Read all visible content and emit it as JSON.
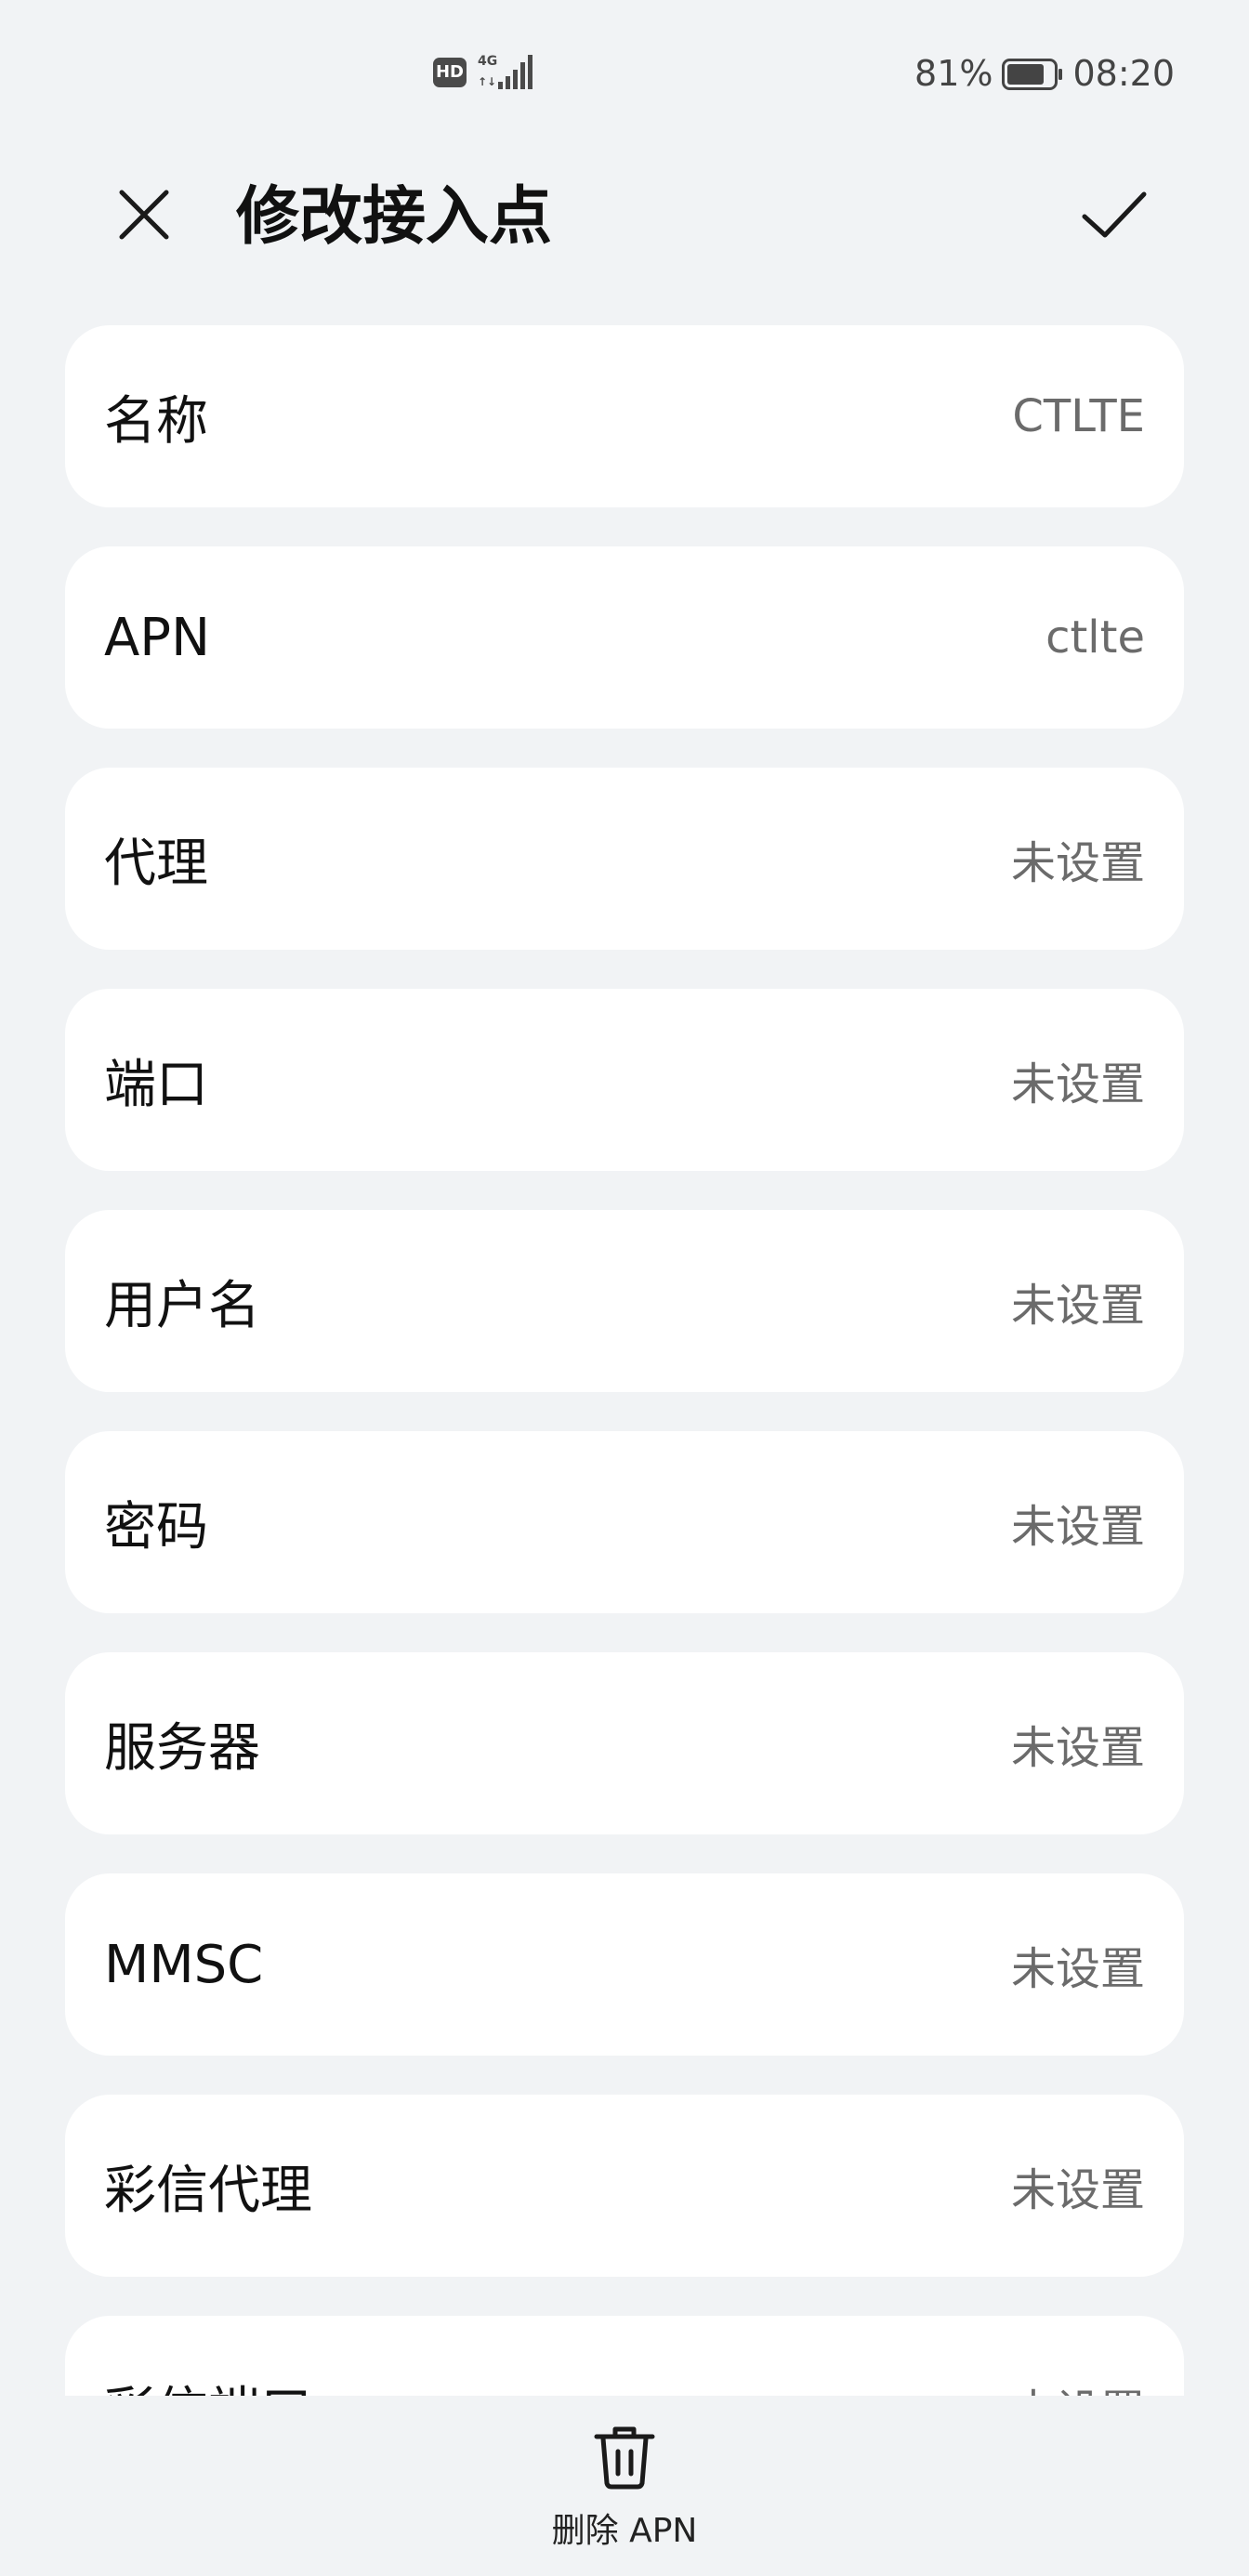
{
  "status_bar": {
    "hd_badge": "HD",
    "network": "4G",
    "battery_percent": "81%",
    "battery_level": 0.81,
    "time": "08:20"
  },
  "app_bar": {
    "title": "修改接入点",
    "close_icon": "close-icon",
    "confirm_icon": "check-icon"
  },
  "fields": [
    {
      "label": "名称",
      "value": "CTLTE"
    },
    {
      "label": "APN",
      "value": "ctlte"
    },
    {
      "label": "代理",
      "value": "未设置"
    },
    {
      "label": "端口",
      "value": "未设置"
    },
    {
      "label": "用户名",
      "value": "未设置"
    },
    {
      "label": "密码",
      "value": "未设置"
    },
    {
      "label": "服务器",
      "value": "未设置"
    },
    {
      "label": "MMSC",
      "value": "未设置"
    },
    {
      "label": "彩信代理",
      "value": "未设置"
    },
    {
      "label": "彩信端口",
      "value": "未设置"
    }
  ],
  "bottom_bar": {
    "delete_label": "删除 APN",
    "delete_icon": "trash-icon"
  },
  "colors": {
    "background": "#f1f3f5",
    "card": "#ffffff",
    "value_text": "#6b6b6b"
  }
}
